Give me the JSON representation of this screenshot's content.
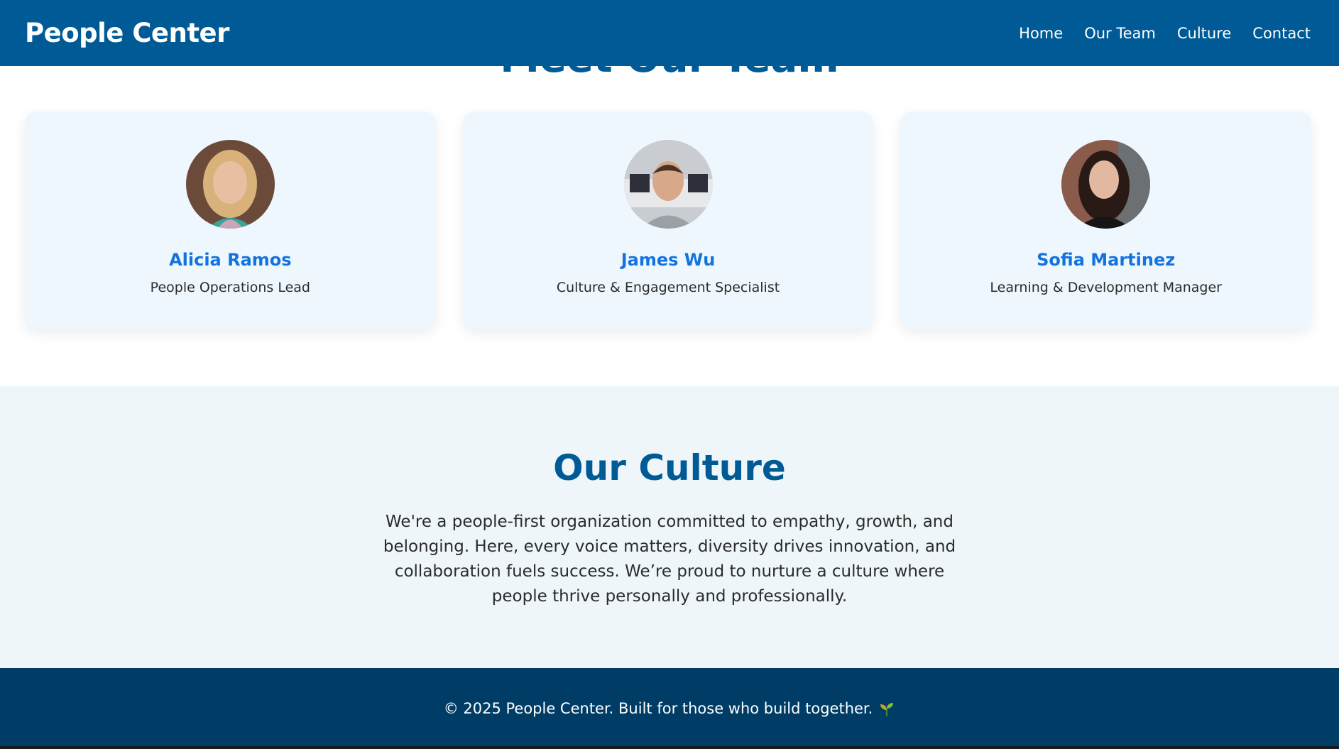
{
  "header": {
    "brand": "People Center",
    "nav": [
      "Home",
      "Our Team",
      "Culture",
      "Contact"
    ]
  },
  "team": {
    "heading": "Meet Our Team",
    "members": [
      {
        "name": "Alicia Ramos",
        "role": "People Operations Lead",
        "avatar": "portrait-woman-blonde"
      },
      {
        "name": "James Wu",
        "role": "Culture & Engagement Specialist",
        "avatar": "portrait-man"
      },
      {
        "name": "Sofia Martinez",
        "role": "Learning & Development Manager",
        "avatar": "portrait-woman-dark-hair"
      }
    ]
  },
  "culture": {
    "title": "Our Culture",
    "body": "We're a people-first organization committed to empathy, growth, and belonging. Here, every voice matters, diversity drives innovation, and collaboration fuels success. We’re proud to nurture a culture where people thrive personally and professionally."
  },
  "footer": {
    "text": "© 2025 People Center. Built for those who build together.",
    "icon": "sprout-icon"
  },
  "colors": {
    "header_bg": "#005a96",
    "accent_name": "#1273e0",
    "card_bg": "#eef7fd",
    "culture_bg": "#eef6f9",
    "footer_bg": "#003d66"
  }
}
